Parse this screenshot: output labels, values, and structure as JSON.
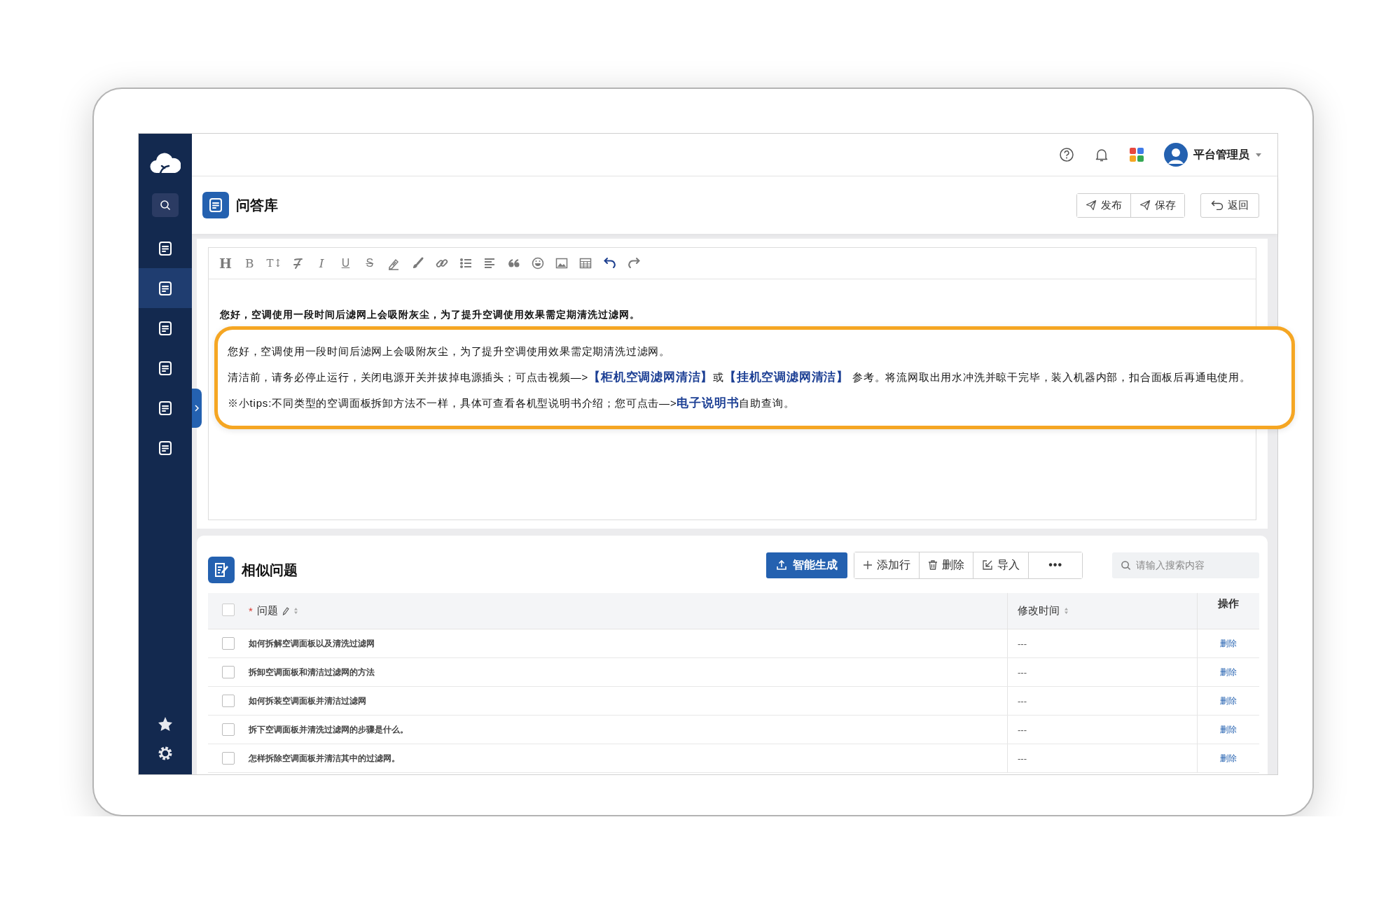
{
  "sidebar": {
    "items": [
      {
        "selected": false
      },
      {
        "selected": true
      },
      {
        "selected": false
      },
      {
        "selected": false
      },
      {
        "selected": false
      },
      {
        "selected": false
      }
    ]
  },
  "topbar": {
    "user": "平台管理员"
  },
  "page": {
    "title": "问答库",
    "actions": [
      "发布",
      "保存"
    ],
    "back": "返回"
  },
  "editor": {
    "tools": [
      {
        "kind": "heading",
        "label": "H",
        "active": false
      },
      {
        "kind": "bold",
        "label": "B",
        "active": false
      },
      {
        "kind": "size",
        "label": "T↕",
        "active": false
      },
      {
        "kind": "clear",
        "active": false
      },
      {
        "kind": "italic",
        "label": "I",
        "active": false
      },
      {
        "kind": "underline",
        "label": "U",
        "active": false
      },
      {
        "kind": "strike",
        "label": "S",
        "active": false
      },
      {
        "kind": "highlight",
        "active": false
      },
      {
        "kind": "brush",
        "active": false
      },
      {
        "kind": "link",
        "active": false
      },
      {
        "kind": "list",
        "active": false
      },
      {
        "kind": "align",
        "active": false
      },
      {
        "kind": "quote",
        "active": false
      },
      {
        "kind": "emoji",
        "active": false
      },
      {
        "kind": "image",
        "active": false
      },
      {
        "kind": "table",
        "active": false
      },
      {
        "kind": "undo",
        "active": true
      },
      {
        "kind": "redo",
        "active": false
      }
    ],
    "text": "您好，空调使用一段时间后滤网上会吸附灰尘，为了提升空调使用效果需定期清洗过滤网。"
  },
  "callout": {
    "paragraphs": [
      [
        {
          "text": "您好，空调使用一段时间后滤网上会吸附灰尘，为了提升空调使用效果需定期清洗过滤网。",
          "link": false
        }
      ],
      [
        {
          "text": "清洁前，请务必停止运行，关闭电源开关并拔掉电源插头；可点击视频—>",
          "link": false
        },
        {
          "text": "【柜机空调滤网清洁】",
          "link": true
        },
        {
          "text": "或",
          "link": false
        },
        {
          "text": "【挂机空调滤网清洁】",
          "link": true
        },
        {
          "text": " 参考。将流网取出用水冲洗并晾干完毕，装入机器内部，扣合面板后再通电使用。",
          "link": false
        }
      ],
      [
        {
          "text": "※小tips:不同类型的空调面板拆卸方法不一样，具体可查看各机型说明书介绍；您可点击—>",
          "link": false
        },
        {
          "text": "电子说明书",
          "link": true
        },
        {
          "text": "自助查询。",
          "link": false
        }
      ]
    ]
  },
  "similar": {
    "title": "相似问题",
    "generate": "智能生成",
    "buttons": [
      {
        "kind": "add",
        "label": "添加行"
      },
      {
        "kind": "delete",
        "label": "删除"
      },
      {
        "kind": "import",
        "label": "导入"
      },
      {
        "kind": "more",
        "label": "•••"
      }
    ],
    "search": {
      "placeholder": "请输入搜索内容"
    },
    "select_all": {
      "checked": false
    },
    "columns": [
      {
        "label": "问题",
        "required_mark": "*",
        "editable": true,
        "sortable": true
      },
      {
        "label": "修改时间",
        "editable": false,
        "sortable": true
      },
      {
        "label": "操作",
        "editable": false,
        "sortable": false
      }
    ],
    "rows": [
      {
        "question": "如何拆解空调面板以及清洗过滤网",
        "time": "---",
        "action": "删除",
        "checked": false
      },
      {
        "question": "拆卸空调面板和清洁过滤网的方法",
        "time": "---",
        "action": "删除",
        "checked": false
      },
      {
        "question": "如何拆装空调面板并清洁过滤网",
        "time": "---",
        "action": "删除",
        "checked": false
      },
      {
        "question": "拆下空调面板并清洗过滤网的步骤是什么。",
        "time": "---",
        "action": "删除",
        "checked": false
      },
      {
        "question": "怎样拆除空调面板并清洁其中的过滤网。",
        "time": "---",
        "action": "删除",
        "checked": false
      }
    ]
  }
}
